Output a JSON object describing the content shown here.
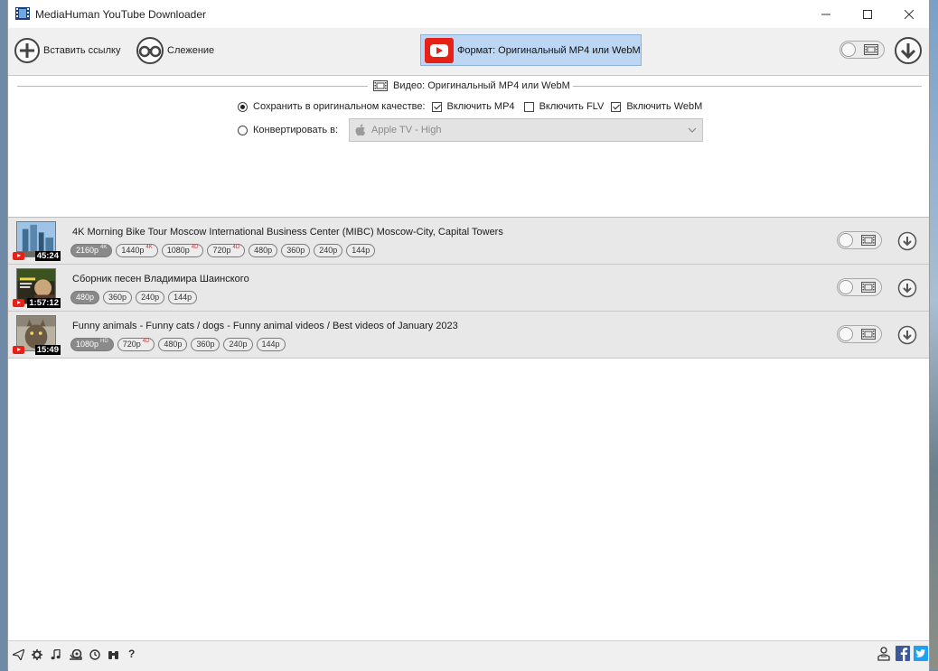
{
  "window": {
    "title": "MediaHuman YouTube Downloader"
  },
  "toolbar": {
    "paste_label": "Вставить ссылку",
    "tracking_label": "Слежение",
    "format_label": "Формат: Оригинальный MP4 или WebM"
  },
  "settings": {
    "header": "Видео: Оригинальный MP4 или WebM",
    "save_original_label": "Сохранить в оригинальном качестве:",
    "mp4_label": "Включить MP4",
    "flv_label": "Включить FLV",
    "webm_label": "Включить WebM",
    "convert_label": "Конвертировать в:",
    "convert_value": "Apple TV - High",
    "save_original_selected": true,
    "mp4_checked": true,
    "flv_checked": false,
    "webm_checked": true
  },
  "videos": [
    {
      "title": "4K Morning Bike Tour Moscow International Business Center (MIBC) Moscow-City, Capital Towers",
      "duration": "45:24",
      "qualities": [
        {
          "label": "2160р",
          "badge": "4K",
          "selected": true
        },
        {
          "label": "1440р",
          "badge": "4K"
        },
        {
          "label": "1080р",
          "badge": "4D"
        },
        {
          "label": "720р",
          "badge": "4D"
        },
        {
          "label": "480р"
        },
        {
          "label": "360р"
        },
        {
          "label": "240р"
        },
        {
          "label": "144р"
        }
      ]
    },
    {
      "title": "Сборник песен Владимира Шаинского",
      "duration": "1:57:12",
      "qualities": [
        {
          "label": "480р",
          "selected": true
        },
        {
          "label": "360р"
        },
        {
          "label": "240р"
        },
        {
          "label": "144р"
        }
      ]
    },
    {
      "title": "Funny animals - Funny cats / dogs - Funny animal videos / Best videos of January 2023",
      "duration": "15:49",
      "qualities": [
        {
          "label": "1080р",
          "badge": "HD",
          "selected": true
        },
        {
          "label": "720р",
          "badge": "4D"
        },
        {
          "label": "480р"
        },
        {
          "label": "360р"
        },
        {
          "label": "240р"
        },
        {
          "label": "144р"
        }
      ]
    }
  ],
  "statusbar": {
    "help_label": "?"
  },
  "colors": {
    "format_bg": "#bcd6f3",
    "youtube_red": "#e62117",
    "item_bg": "#e8e8e8"
  }
}
